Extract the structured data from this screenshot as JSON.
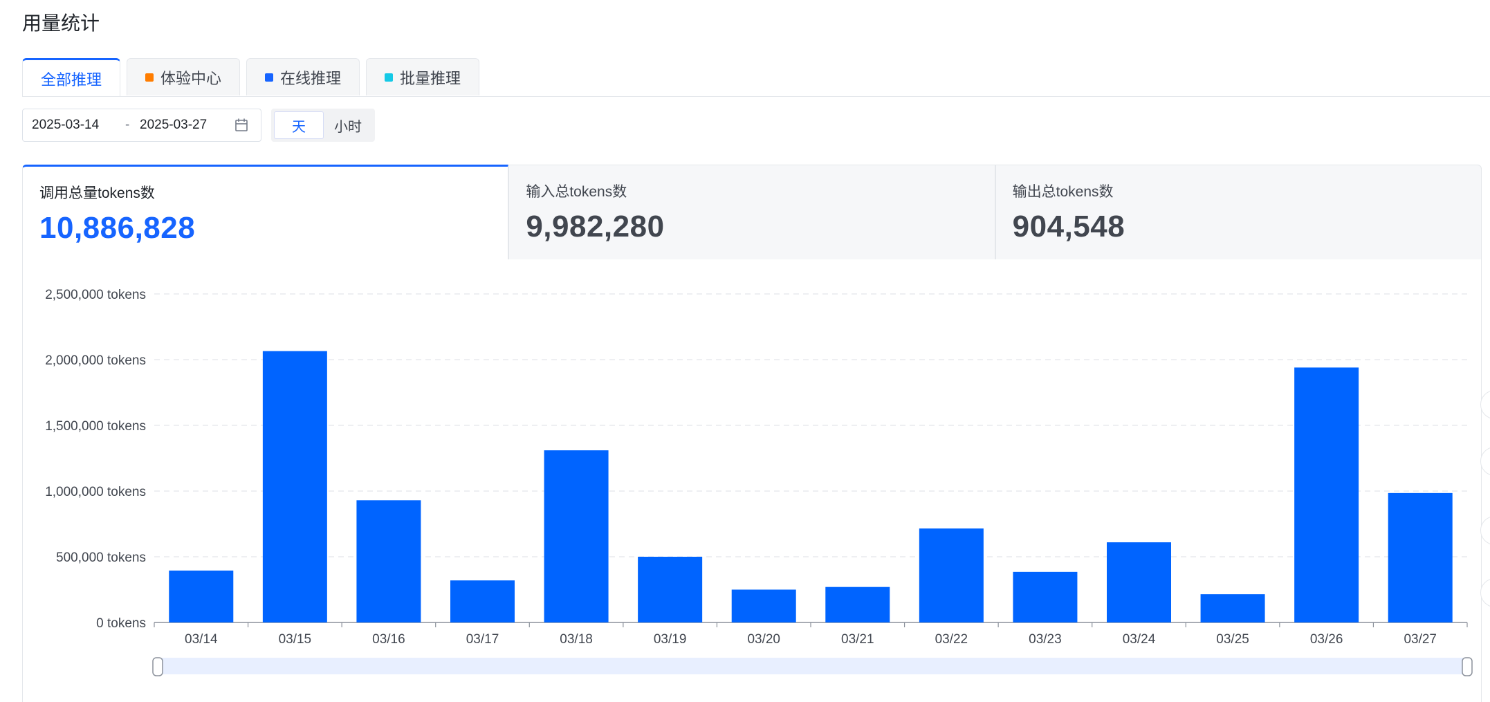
{
  "page": {
    "title": "用量统计"
  },
  "tabs": [
    {
      "label": "全部推理",
      "active": true
    },
    {
      "label": "体验中心",
      "color": "#ff7d00"
    },
    {
      "label": "在线推理",
      "color": "#1664ff"
    },
    {
      "label": "批量推理",
      "color": "#14c9e6"
    }
  ],
  "filters": {
    "start_date": "2025-03-14",
    "separator": "-",
    "end_date": "2025-03-27",
    "granularity": [
      {
        "label": "天",
        "selected": true
      },
      {
        "label": "小时",
        "selected": false
      }
    ]
  },
  "stats": [
    {
      "label": "调用总量tokens数",
      "value": "10,886,828"
    },
    {
      "label": "输入总tokens数",
      "value": "9,982,280"
    },
    {
      "label": "输出总tokens数",
      "value": "904,548"
    }
  ],
  "colors": {
    "accent": "#1664ff",
    "bar": "#0064ff"
  },
  "chart_data": {
    "type": "bar",
    "categories": [
      "03/14",
      "03/15",
      "03/16",
      "03/17",
      "03/18",
      "03/19",
      "03/20",
      "03/21",
      "03/22",
      "03/23",
      "03/24",
      "03/25",
      "03/26",
      "03/27"
    ],
    "values": [
      395000,
      2065000,
      930000,
      320000,
      1310000,
      500000,
      250000,
      270000,
      715000,
      385000,
      610000,
      215000,
      1940000,
      985000
    ],
    "ylim": [
      0,
      2500000
    ],
    "yticks": [
      0,
      500000,
      1000000,
      1500000,
      2000000,
      2500000
    ],
    "ytick_labels": [
      "0 tokens",
      "500,000 tokens",
      "1,000,000 tokens",
      "1,500,000 tokens",
      "2,000,000 tokens",
      "2,500,000 tokens"
    ],
    "grid": true
  }
}
